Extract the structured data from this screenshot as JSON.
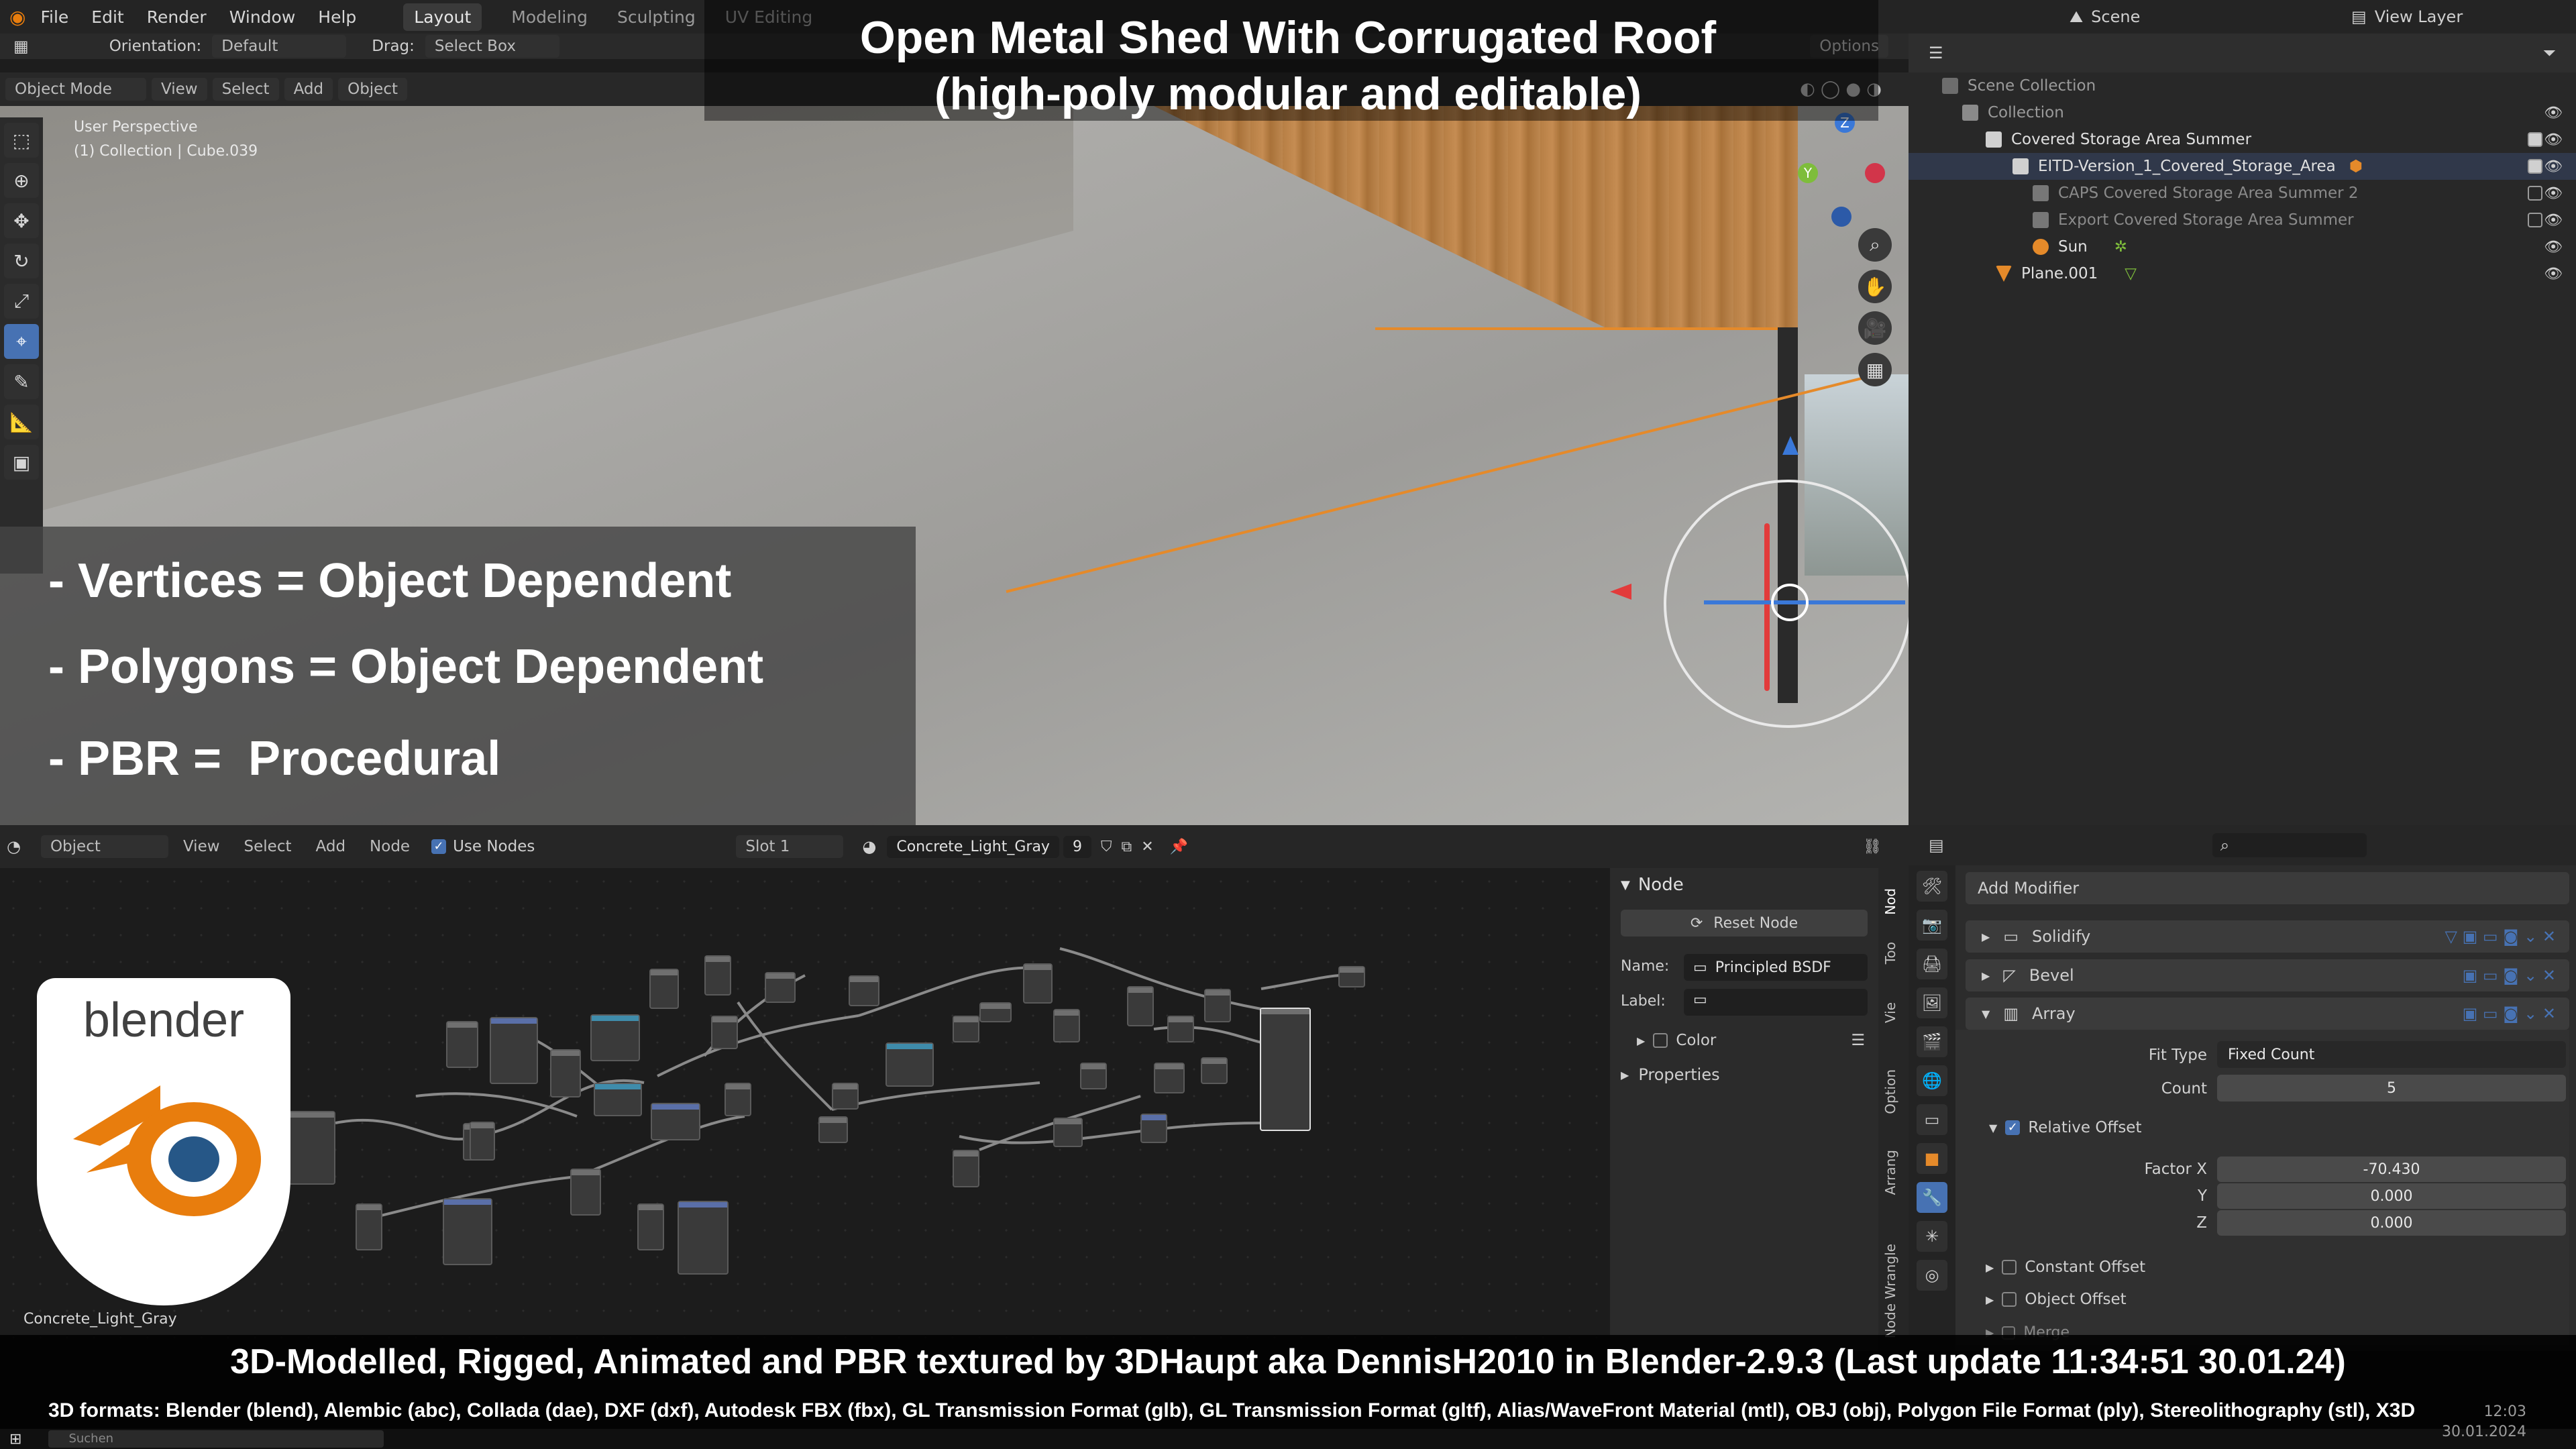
{
  "overlay": {
    "title_line1": "Open Metal Shed With Corrugated Roof",
    "title_line2": "(high-poly modular and editable)",
    "specs": [
      "- Vertices = Object Dependent",
      "- Polygons = Object Dependent",
      "- PBR =  Procedural"
    ],
    "credit": "3D-Modelled, Rigged, Animated and PBR textured by 3DHaupt aka DennisH2010 in Blender-2.9.3 (Last update 11:34:51  30.01.24)",
    "formats": "3D formats: Blender (blend), Alembic (abc), Collada (dae), DXF (dxf), Autodesk FBX (fbx), GL Transmission Format (glb), GL Transmission Format (gltf), Alias/WaveFront Material (mtl), OBJ (obj), Polygon File Format (ply), Stereolithography (stl), X3D"
  },
  "menu": {
    "items": [
      "File",
      "Edit",
      "Render",
      "Window",
      "Help"
    ],
    "workspaces": [
      "Layout",
      "Modeling",
      "Sculpting",
      "UV Editing"
    ],
    "active_workspace": "Layout"
  },
  "viewport_header": {
    "orientation_label": "Orientation:",
    "orientation_value": "Default",
    "drag_label": "Drag:",
    "drag_value": "Select Box",
    "options": "Options",
    "mode": "Object Mode",
    "buttons": [
      "View",
      "Select",
      "Add",
      "Object"
    ]
  },
  "viewport": {
    "perspective": "User Perspective",
    "collection_info": "(1) Collection | Cube.039",
    "nav_axes": [
      "Z",
      "Y"
    ]
  },
  "outliner": {
    "scene": "Scene",
    "view_layer": "View Layer",
    "rows": [
      {
        "label": "Scene Collection",
        "indent": 0
      },
      {
        "label": "Collection",
        "indent": 1
      },
      {
        "label": "Covered Storage Area Summer",
        "indent": 2
      },
      {
        "label": "EITD-Version_1_Covered_Storage_Area",
        "indent": 3
      },
      {
        "label": "CAPS Covered Storage Area Summer 2",
        "indent": 3
      },
      {
        "label": "Export Covered Storage Area Summer",
        "indent": 3
      },
      {
        "label": "Sun",
        "indent": 3
      },
      {
        "label": "Plane.001",
        "indent": 2
      }
    ]
  },
  "node_editor": {
    "object_menu": "Object",
    "menus": [
      "View",
      "Select",
      "Add",
      "Node"
    ],
    "use_nodes": "Use Nodes",
    "slot": "Slot 1",
    "material": "Concrete_Light_Gray",
    "user_count": "9",
    "material_footer": "Concrete_Light_Gray",
    "sidebar": {
      "section": "Node",
      "reset": "Reset Node",
      "name_label": "Name:",
      "name_value": "Principled BSDF",
      "label_label": "Label:",
      "color": "Color",
      "properties": "Properties"
    },
    "tabs": [
      "Nod",
      "Too",
      "Vie",
      "Option",
      "Arrang",
      "Node Wrangle"
    ]
  },
  "properties": {
    "add_modifier": "Add Modifier",
    "modifiers": [
      "Solidify",
      "Bevel",
      "Array"
    ],
    "fit_type_label": "Fit Type",
    "fit_type_value": "Fixed Count",
    "count_label": "Count",
    "count_value": "5",
    "relative_offset": "Relative Offset",
    "factor_x_label": "Factor X",
    "factor_x": "-70.430",
    "y_label": "Y",
    "factor_y": "0.000",
    "z_label": "Z",
    "factor_z": "0.000",
    "constant_offset": "Constant Offset",
    "object_offset": "Object Offset",
    "merge": "Merge"
  },
  "logo": {
    "text": "blender"
  },
  "taskbar": {
    "search": "Suchen",
    "time": "12:03",
    "date": "30.01.2024"
  },
  "colors": {
    "selection_orange": "#e58a2a",
    "accent_blue": "#4772b3",
    "blender_orange": "#e87d0d",
    "blender_blue": "#265787"
  }
}
